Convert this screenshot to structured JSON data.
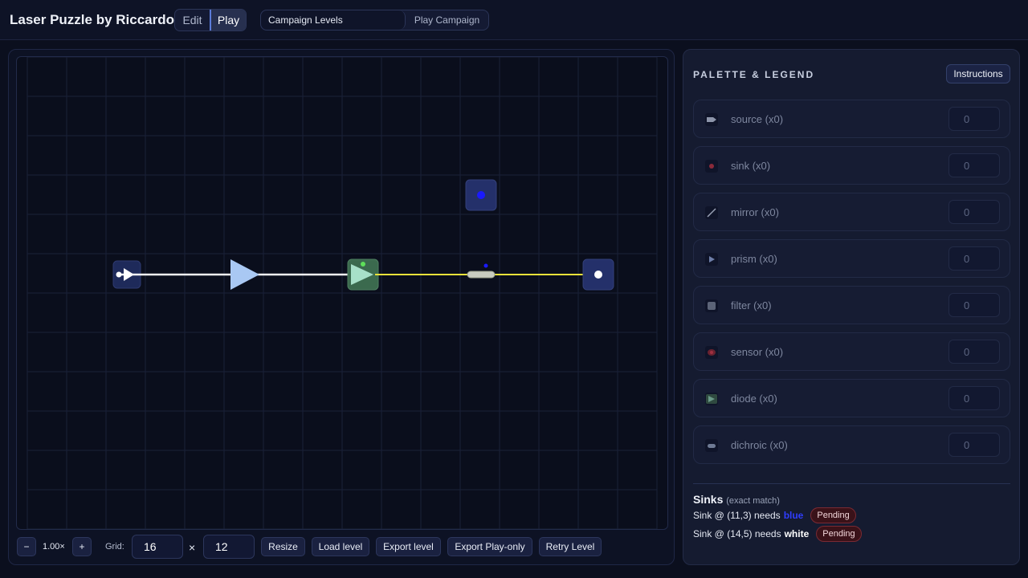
{
  "header": {
    "title": "Laser Puzzle by Riccardo",
    "modes": [
      "Edit",
      "Play"
    ],
    "active_mode": "Play",
    "campaign_select": "Campaign Levels",
    "campaign_play": "Play Campaign"
  },
  "board": {
    "columns": 16,
    "rows": 12
  },
  "toolbar": {
    "zoom_out": "−",
    "zoom_level": "1.00×",
    "zoom_in": "+",
    "grid_label": "Grid:",
    "grid_width": "16",
    "times": "×",
    "grid_height": "12",
    "resize": "Resize",
    "load": "Load level",
    "export": "Export level",
    "export_play": "Export Play-only",
    "retry": "Retry Level"
  },
  "palette": {
    "title": "PALETTE & LEGEND",
    "instructions": "Instructions",
    "items": [
      {
        "label": "source (x0)",
        "count": "0",
        "icon": "source-icon"
      },
      {
        "label": "sink (x0)",
        "count": "0",
        "icon": "sink-icon"
      },
      {
        "label": "mirror (x0)",
        "count": "0",
        "icon": "mirror-icon"
      },
      {
        "label": "prism (x0)",
        "count": "0",
        "icon": "prism-icon"
      },
      {
        "label": "filter (x0)",
        "count": "0",
        "icon": "filter-icon"
      },
      {
        "label": "sensor (x0)",
        "count": "0",
        "icon": "sensor-icon"
      },
      {
        "label": "diode (x0)",
        "count": "0",
        "icon": "diode-icon"
      },
      {
        "label": "dichroic (x0)",
        "count": "0",
        "icon": "dichroic-icon"
      }
    ]
  },
  "sinks": {
    "title": "Sinks",
    "subtitle": "(exact match)",
    "rows": [
      {
        "prefix": "Sink @ (11,3) needs",
        "color_name": "blue",
        "color_hex": "#2f3dff",
        "status": "Pending"
      },
      {
        "prefix": "Sink @ (14,5) needs",
        "color_name": "white",
        "color_hex": "#ffffff",
        "status": "Pending"
      }
    ]
  },
  "colors": {
    "beam_white": "#f2f2f2",
    "beam_yellow": "#e8e23a",
    "sink_blue": "#1a1aff",
    "badge_border": "#7a2a33"
  }
}
